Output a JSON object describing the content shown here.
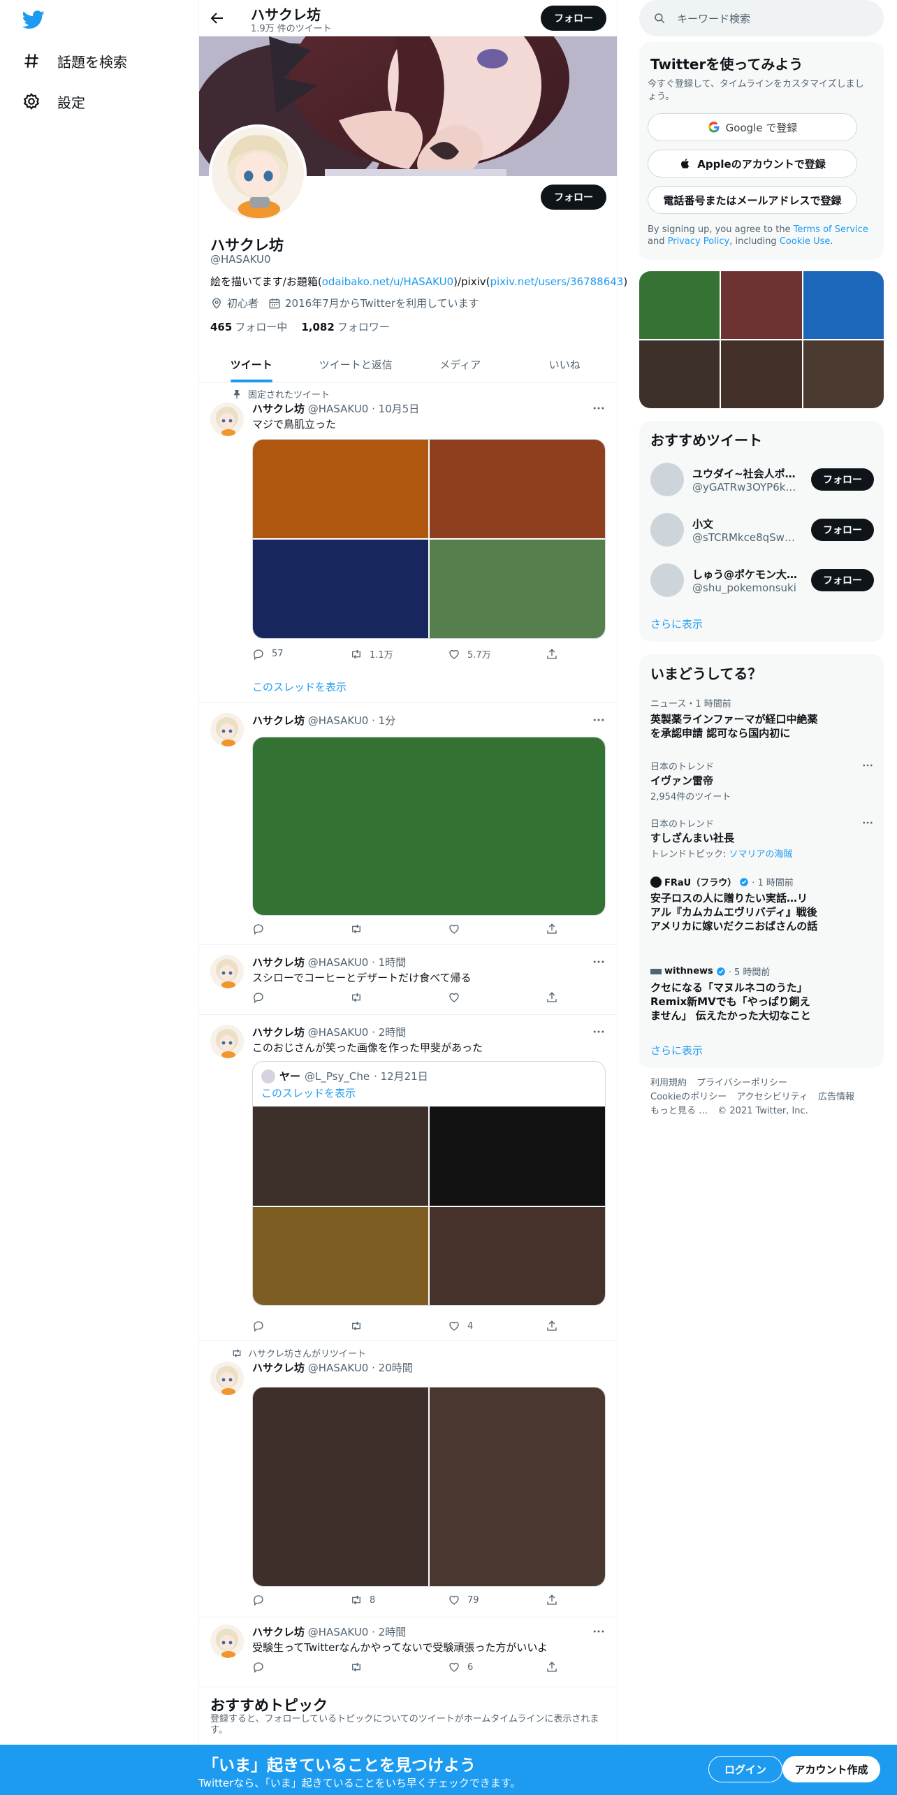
{
  "nav": {
    "explore_label": "話題を検索",
    "settings_label": "設定"
  },
  "header": {
    "name": "ハサクレ坊",
    "tweet_count": "1.9万 件のツイート",
    "follow_label": "フォロー"
  },
  "profile": {
    "name": "ハサクレ坊",
    "handle": "@HASAKU0",
    "follow_label": "フォロー",
    "bio_prefix": "絵を描いてます/お題箱(",
    "bio_link1": "odaibako.net/u/HASAKU0",
    "bio_mid": ")/pixiv(",
    "bio_link2": "pixiv.net/users/36788643",
    "bio_suffix": ")",
    "location": "初心者",
    "joined": "2016年7月からTwitterを利用しています",
    "following_count": "465",
    "following_label": "フォロー中",
    "followers_count": "1,082",
    "followers_label": "フォロワー"
  },
  "tabs": [
    {
      "label": "ツイート"
    },
    {
      "label": "ツイートと返信"
    },
    {
      "label": "メディア"
    },
    {
      "label": "いいね"
    }
  ],
  "tweets": [
    {
      "social": "固定されたツイート",
      "name": "ハサクレ坊",
      "handle": "@HASAKU0",
      "time": "· 10月5日",
      "text": "マジで鳥肌立った",
      "reply": "57",
      "retweet": "1.1万",
      "like": "5.7万",
      "show_thread": "このスレッドを表示",
      "media_colors": [
        "#b0570f",
        "#8e3f1d",
        "#17265c",
        "#557f4c"
      ]
    },
    {
      "name": "ハサクレ坊",
      "handle": "@HASAKU0",
      "time": "· 1分",
      "media_colors": [
        "#347234"
      ]
    },
    {
      "name": "ハサクレ坊",
      "handle": "@HASAKU0",
      "time": "· 1時間",
      "text": "スシローでコーヒーとデザートだけ食べて帰る"
    },
    {
      "name": "ハサクレ坊",
      "handle": "@HASAKU0",
      "time": "· 2時間",
      "text": "このおじさんが笑った画像を作った甲斐があった",
      "like": "4",
      "quote": {
        "name": "ヤー",
        "handle": "@L_Psy_Che",
        "time": "· 12月21日",
        "show_thread": "このスレッドを表示"
      },
      "media_colors": [
        "#3d302b",
        "#121212",
        "#7e5d23",
        "#47312b"
      ]
    },
    {
      "social": "ハサクレ坊さんがリツイート",
      "name": "ハサクレ坊",
      "handle": "@HASAKU0",
      "time": "· 20時間",
      "retweet": "8",
      "like": "79",
      "media_colors": [
        "#3f2f2a",
        "#4a3730"
      ]
    },
    {
      "name": "ハサクレ坊",
      "handle": "@HASAKU0",
      "time": "· 2時間",
      "text": "受験生ってTwitterなんかやってないで受験頑張った方がいいよ",
      "like": "6"
    }
  ],
  "topics": {
    "title": "おすすめトピック",
    "sub": "登録すると、フォローしているトピックについてのツイートがホームタイムラインに表示されます。"
  },
  "right": {
    "search_placeholder": "キーワード検索",
    "signup": {
      "title": "Twitterを使ってみよう",
      "sub": "今すぐ登録して、タイムラインをカスタマイズしましょう。",
      "google": "Google で登録",
      "apple": "Appleのアカウントで登録",
      "phone": "電話番号またはメールアドレスで登録",
      "terms_prefix": "By signing up, you agree to the ",
      "terms_link": "Terms of Service",
      "terms_and": " and",
      "privacy_link": "Privacy Policy",
      "including": ", including ",
      "cookie_link": "Cookie Use",
      "period": "."
    },
    "photo_colors": [
      "#367234",
      "#6d3232",
      "#1c67ba",
      "#3d302b",
      "#433129",
      "#4a3a2f"
    ],
    "suggested": {
      "title": "おすすめツイート",
      "users": [
        {
          "name": "ユウダイ~社会人ポ…",
          "handle": "@yGATRw3OYP6kNIr"
        },
        {
          "name": "小文",
          "handle": "@sTCRMkce8qSwn…"
        },
        {
          "name": "しゅう@ポケモン大…",
          "handle": "@shu_pokemonsuki"
        }
      ],
      "follow_label": "フォロー",
      "more": "さらに表示"
    },
    "trends": {
      "title": "いまどうしてる？",
      "items": [
        {
          "cat": "ニュース・1 時間前",
          "name": "英製薬ラインファーマが経口中絶薬を承認申請 認可なら国内初に"
        },
        {
          "cat": "日本のトレンド",
          "name": "イヴァン雷帝",
          "sub": "2,954件のツイート"
        },
        {
          "cat": "日本のトレンド",
          "name": "すしざんまい社長",
          "sub_prefix": "トレンドトピック: ",
          "sub_link": "ソマリアの海賊"
        },
        {
          "source": "FRaU（フラウ）",
          "time": "· 1 時間前",
          "name": "安子ロスの人に贈りたい実話…リアル『カムカムエヴリバディ』戦後アメリカに嫁いだクニおばさんの話"
        },
        {
          "source": "withnews",
          "time": "· 5 時間前",
          "name": "クセになる「マヌルネコのうた」Remix新MVでも「やっぱり飼えません」 伝えたかった大切なこと"
        }
      ],
      "more": "さらに表示"
    },
    "footer": [
      "利用規約",
      "プライバシーポリシー",
      "Cookieのポリシー",
      "アクセシビリティ",
      "広告情報",
      "もっと見る …",
      "© 2021 Twitter, Inc."
    ]
  },
  "bottom": {
    "headline": "「いま」起きていることを見つけよう",
    "sub": "Twitterなら、「いま」起きていることをいち早くチェックできます。",
    "login": "ログイン",
    "signup": "アカウント作成"
  },
  "colors": {
    "accent": "#1d9bf0",
    "dark": "#0f1419",
    "muted": "#536471"
  }
}
